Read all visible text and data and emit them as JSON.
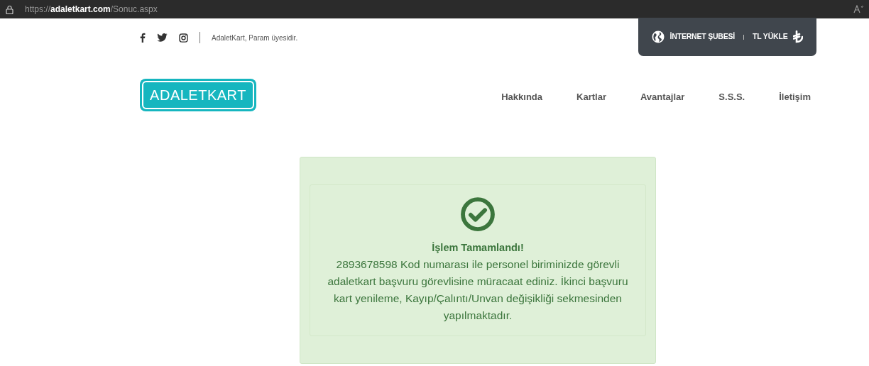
{
  "browser": {
    "url": "https://**adaletkart.com**/Sonuc.aspx"
  },
  "topbar": {
    "social": [
      {
        "kind": "facebook"
      },
      {
        "kind": "twitter"
      },
      {
        "kind": "instagram"
      }
    ],
    "tagline": "AdaletKart, Param üyesidir.",
    "links": [
      {
        "kind": "globe",
        "label": "İNTERNET ŞUBESİ"
      },
      {
        "kind": "lira",
        "label": "TL YÜKLE"
      }
    ]
  },
  "logo": {
    "text": "ADALETKART"
  },
  "nav": [
    {
      "label": "Hakkında"
    },
    {
      "label": "Kartlar"
    },
    {
      "label": "Avantajlar"
    },
    {
      "label": "S.S.S."
    },
    {
      "label": "İletişim"
    }
  ],
  "result": {
    "title": "İşlem Tamamlandı!",
    "message": "2893678598 Kod numarası ile personel biriminizde görevli adaletkart başvuru görevlisine müracaat ediniz. İkinci başvuru kart yenileme, Kayıp/Çalıntı/Unvan değişikliği sekmesinden yapılmaktadır."
  }
}
